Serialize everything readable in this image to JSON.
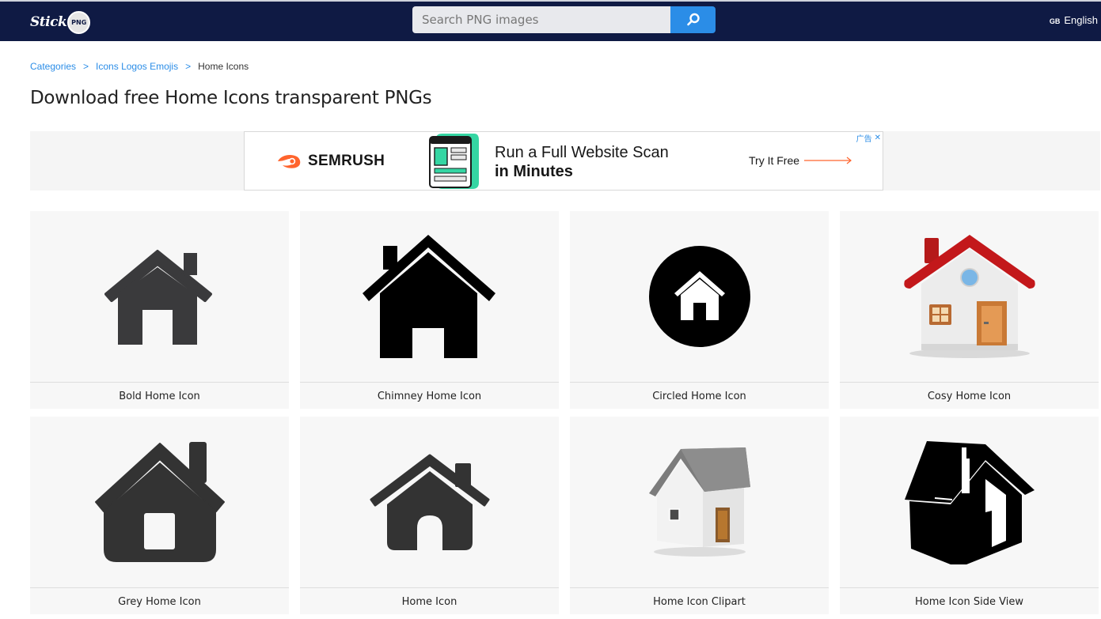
{
  "header": {
    "logo_text": "Stick",
    "logo_badge": "PNG",
    "search_placeholder": "Search PNG images",
    "language_flag": "GB",
    "language": "English"
  },
  "breadcrumb": {
    "items": [
      "Categories",
      "Icons Logos Emojis"
    ],
    "separator": ">",
    "current": "Home Icons"
  },
  "page_title": "Download free Home Icons transparent PNGs",
  "ad": {
    "brand": "SEMRUSH",
    "headline_line1": "Run a Full Website Scan",
    "headline_line2": "in Minutes",
    "cta": "Try It Free",
    "choices_label": "广告",
    "close": "✕"
  },
  "cards": [
    {
      "label": "Bold Home Icon",
      "icon": "bold-home-icon"
    },
    {
      "label": "Chimney Home Icon",
      "icon": "chimney-home-icon"
    },
    {
      "label": "Circled Home Icon",
      "icon": "circled-home-icon"
    },
    {
      "label": "Cosy Home Icon",
      "icon": "cosy-home-icon"
    },
    {
      "label": "Grey Home Icon",
      "icon": "grey-home-icon"
    },
    {
      "label": "Home Icon",
      "icon": "home-icon"
    },
    {
      "label": "Home Icon Clipart",
      "icon": "home-clipart-icon"
    },
    {
      "label": "Home Icon Side View",
      "icon": "home-side-view-icon"
    }
  ],
  "colors": {
    "header_bg": "#0f1a44",
    "accent": "#2b8de7",
    "card_bg": "#f7f7f7",
    "ad_orange": "#ff642d"
  }
}
